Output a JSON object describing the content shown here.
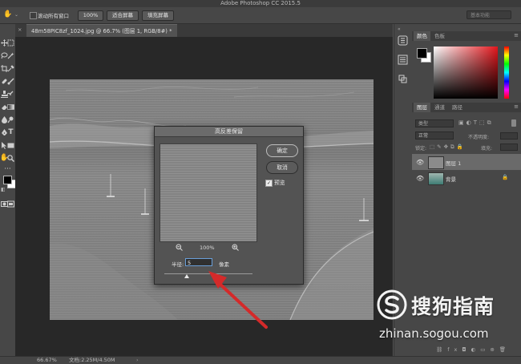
{
  "app": {
    "title": "Adobe Photoshop CC 2015.5"
  },
  "options_bar": {
    "scroll_all_label": "滚动所有窗口",
    "zoom_100": "100%",
    "fit_screen": "适合屏幕",
    "fill_screen": "填充屏幕",
    "workspace": "基本功能"
  },
  "document": {
    "tab_title": "48m58PIC8zf_1024.jpg @ 66.7% (图层 1, RGB/8#) *"
  },
  "dialog": {
    "title": "高反差保留",
    "ok": "确定",
    "cancel": "取消",
    "preview_label": "预览",
    "zoom_percent": "100%",
    "radius_label": "半径:",
    "radius_value": "5",
    "radius_unit": "像素",
    "slider_fraction": 0.25
  },
  "panels": {
    "color_tabs": [
      "颜色",
      "色板"
    ],
    "layer_tabs": [
      "图层",
      "通道",
      "路径"
    ],
    "kind_filter": "类型",
    "blend_mode": "正常",
    "opacity_label": "不透明度:",
    "lock_label": "锁定:",
    "fill_label": "填充:",
    "layers": [
      {
        "name": "图层 1",
        "selected": true
      },
      {
        "name": "背景",
        "selected": false,
        "locked": true
      }
    ]
  },
  "status": {
    "zoom": "66.67%",
    "doc_size": "文档:2.25M/4.50M"
  },
  "watermark": {
    "brand": "搜狗指南",
    "url": "zhinan.sogou.com"
  },
  "colors": {
    "accent_arrow": "#d42a2a",
    "input_focus": "#6a9fd8"
  }
}
